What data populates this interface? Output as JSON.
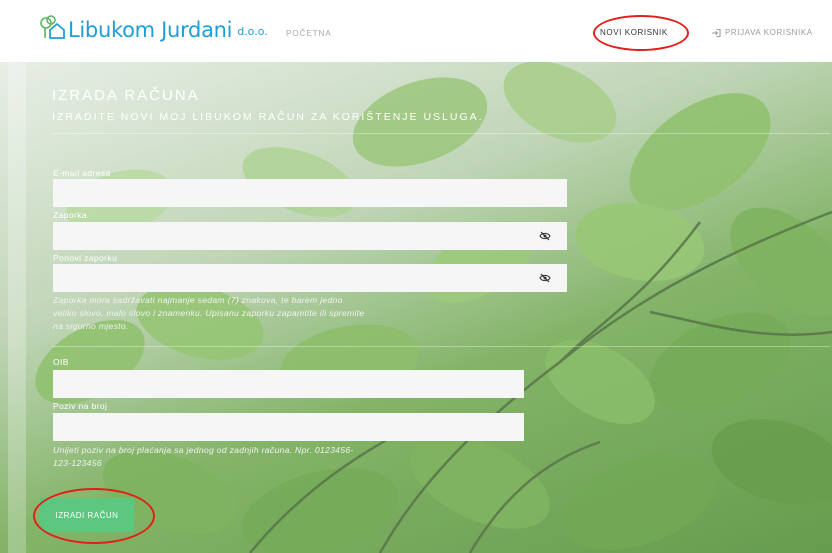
{
  "header": {
    "brand_name": "Libukom Jurdani",
    "brand_suffix": "d.o.o.",
    "nav_home": "POČETNA",
    "nav_new_user": "NOVI KORISNIK",
    "nav_login": "PRIJAVA KORISNIKA"
  },
  "form": {
    "title": "IZRADA RAČUNA",
    "subtitle": "IZRADITE NOVI MOJ LIBUKOM RAČUN ZA KORIŠTENJE USLUGA.",
    "email_label": "E-mail adresa",
    "email_value": "",
    "password_label": "Zaporka",
    "password_value": "",
    "repeat_password_label": "Ponovi zaporku",
    "repeat_password_value": "",
    "password_hint_line1": "Zaporka mora sadržavati najmanje sedam (7) znakova, te barem jedno",
    "password_hint_line2": "veliko slovo, malo slovo i znamenku. Upisanu zaporku zapamtite ili spremite",
    "password_hint_line3": "na sigurno mjesto.",
    "oib_label": "OIB",
    "oib_value": "",
    "reference_label": "Poziv na broj",
    "reference_value": "",
    "reference_hint_line1": "Unijeti poziv na broj plaćanja sa jednog od zadnjih računa. Npr. 0123456-",
    "reference_hint_line2": "123-123456",
    "submit_label": "IZRADI RAČUN"
  },
  "colors": {
    "brand_blue": "#1e9ed8",
    "submit_green": "#5cc77e",
    "highlight_red": "#e0201a"
  },
  "icons": {
    "logo": "tree-house-icon",
    "login": "sign-in-icon",
    "password_toggle": "eye-slash-icon"
  }
}
